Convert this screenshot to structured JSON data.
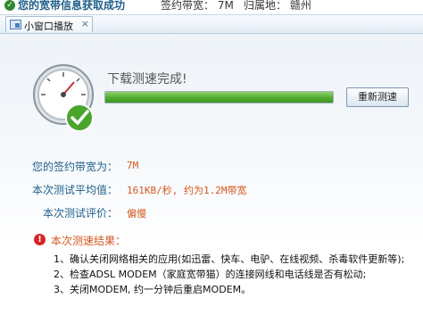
{
  "topbar": {
    "status_text": "您的宽带信息获取成功",
    "contract_text": "签约带宽：  7M",
    "location_text": "归属地：  赣州",
    "status_icon": "check-icon"
  },
  "tabs": [
    {
      "label": "小窗口播放",
      "close": "×"
    }
  ],
  "test": {
    "done_text": "下载测速完成!",
    "progress_percent": 100,
    "retest_label": "重新测速"
  },
  "info": {
    "bandwidth_label": "您的签约带宽为：",
    "bandwidth_value": "7M",
    "average_label": "本次测试平均值：",
    "average_value": "161KB/秒, 约为1.2M带宽",
    "rating_label": "本次测试评价：",
    "rating_value": "偏慢"
  },
  "result": {
    "title": "本次测速结果：",
    "items": [
      "1、确认关闭网络相关的应用(如迅雷、快车、电驴、在线视频、杀毒软件更新等);",
      "2、检查ADSL MODEM（家庭宽带猫）的连接网线和电话线是否有松动;",
      "3、关闭MODEM, 约一分钟后重启MODEM。"
    ]
  },
  "colors": {
    "accent_blue": "#1f5f8a",
    "value_orange": "#d4571e",
    "progress_green": "#4ea82d",
    "warning_red": "#d62424"
  }
}
